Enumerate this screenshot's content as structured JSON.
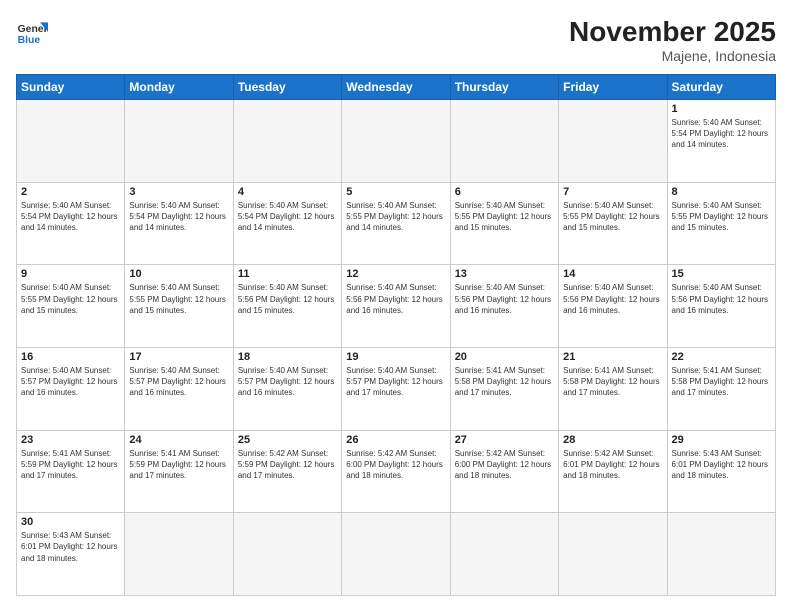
{
  "header": {
    "logo_general": "General",
    "logo_blue": "Blue",
    "month_year": "November 2025",
    "location": "Majene, Indonesia"
  },
  "days_of_week": [
    "Sunday",
    "Monday",
    "Tuesday",
    "Wednesday",
    "Thursday",
    "Friday",
    "Saturday"
  ],
  "weeks": [
    [
      {
        "day": "",
        "info": ""
      },
      {
        "day": "",
        "info": ""
      },
      {
        "day": "",
        "info": ""
      },
      {
        "day": "",
        "info": ""
      },
      {
        "day": "",
        "info": ""
      },
      {
        "day": "",
        "info": ""
      },
      {
        "day": "1",
        "info": "Sunrise: 5:40 AM\nSunset: 5:54 PM\nDaylight: 12 hours\nand 14 minutes."
      }
    ],
    [
      {
        "day": "2",
        "info": "Sunrise: 5:40 AM\nSunset: 5:54 PM\nDaylight: 12 hours\nand 14 minutes."
      },
      {
        "day": "3",
        "info": "Sunrise: 5:40 AM\nSunset: 5:54 PM\nDaylight: 12 hours\nand 14 minutes."
      },
      {
        "day": "4",
        "info": "Sunrise: 5:40 AM\nSunset: 5:54 PM\nDaylight: 12 hours\nand 14 minutes."
      },
      {
        "day": "5",
        "info": "Sunrise: 5:40 AM\nSunset: 5:55 PM\nDaylight: 12 hours\nand 14 minutes."
      },
      {
        "day": "6",
        "info": "Sunrise: 5:40 AM\nSunset: 5:55 PM\nDaylight: 12 hours\nand 15 minutes."
      },
      {
        "day": "7",
        "info": "Sunrise: 5:40 AM\nSunset: 5:55 PM\nDaylight: 12 hours\nand 15 minutes."
      },
      {
        "day": "8",
        "info": "Sunrise: 5:40 AM\nSunset: 5:55 PM\nDaylight: 12 hours\nand 15 minutes."
      }
    ],
    [
      {
        "day": "9",
        "info": "Sunrise: 5:40 AM\nSunset: 5:55 PM\nDaylight: 12 hours\nand 15 minutes."
      },
      {
        "day": "10",
        "info": "Sunrise: 5:40 AM\nSunset: 5:55 PM\nDaylight: 12 hours\nand 15 minutes."
      },
      {
        "day": "11",
        "info": "Sunrise: 5:40 AM\nSunset: 5:56 PM\nDaylight: 12 hours\nand 15 minutes."
      },
      {
        "day": "12",
        "info": "Sunrise: 5:40 AM\nSunset: 5:56 PM\nDaylight: 12 hours\nand 16 minutes."
      },
      {
        "day": "13",
        "info": "Sunrise: 5:40 AM\nSunset: 5:56 PM\nDaylight: 12 hours\nand 16 minutes."
      },
      {
        "day": "14",
        "info": "Sunrise: 5:40 AM\nSunset: 5:56 PM\nDaylight: 12 hours\nand 16 minutes."
      },
      {
        "day": "15",
        "info": "Sunrise: 5:40 AM\nSunset: 5:56 PM\nDaylight: 12 hours\nand 16 minutes."
      }
    ],
    [
      {
        "day": "16",
        "info": "Sunrise: 5:40 AM\nSunset: 5:57 PM\nDaylight: 12 hours\nand 16 minutes."
      },
      {
        "day": "17",
        "info": "Sunrise: 5:40 AM\nSunset: 5:57 PM\nDaylight: 12 hours\nand 16 minutes."
      },
      {
        "day": "18",
        "info": "Sunrise: 5:40 AM\nSunset: 5:57 PM\nDaylight: 12 hours\nand 16 minutes."
      },
      {
        "day": "19",
        "info": "Sunrise: 5:40 AM\nSunset: 5:57 PM\nDaylight: 12 hours\nand 17 minutes."
      },
      {
        "day": "20",
        "info": "Sunrise: 5:41 AM\nSunset: 5:58 PM\nDaylight: 12 hours\nand 17 minutes."
      },
      {
        "day": "21",
        "info": "Sunrise: 5:41 AM\nSunset: 5:58 PM\nDaylight: 12 hours\nand 17 minutes."
      },
      {
        "day": "22",
        "info": "Sunrise: 5:41 AM\nSunset: 5:58 PM\nDaylight: 12 hours\nand 17 minutes."
      }
    ],
    [
      {
        "day": "23",
        "info": "Sunrise: 5:41 AM\nSunset: 5:59 PM\nDaylight: 12 hours\nand 17 minutes."
      },
      {
        "day": "24",
        "info": "Sunrise: 5:41 AM\nSunset: 5:59 PM\nDaylight: 12 hours\nand 17 minutes."
      },
      {
        "day": "25",
        "info": "Sunrise: 5:42 AM\nSunset: 5:59 PM\nDaylight: 12 hours\nand 17 minutes."
      },
      {
        "day": "26",
        "info": "Sunrise: 5:42 AM\nSunset: 6:00 PM\nDaylight: 12 hours\nand 18 minutes."
      },
      {
        "day": "27",
        "info": "Sunrise: 5:42 AM\nSunset: 6:00 PM\nDaylight: 12 hours\nand 18 minutes."
      },
      {
        "day": "28",
        "info": "Sunrise: 5:42 AM\nSunset: 6:01 PM\nDaylight: 12 hours\nand 18 minutes."
      },
      {
        "day": "29",
        "info": "Sunrise: 5:43 AM\nSunset: 6:01 PM\nDaylight: 12 hours\nand 18 minutes."
      }
    ],
    [
      {
        "day": "30",
        "info": "Sunrise: 5:43 AM\nSunset: 6:01 PM\nDaylight: 12 hours\nand 18 minutes."
      },
      {
        "day": "",
        "info": ""
      },
      {
        "day": "",
        "info": ""
      },
      {
        "day": "",
        "info": ""
      },
      {
        "day": "",
        "info": ""
      },
      {
        "day": "",
        "info": ""
      },
      {
        "day": "",
        "info": ""
      }
    ]
  ]
}
